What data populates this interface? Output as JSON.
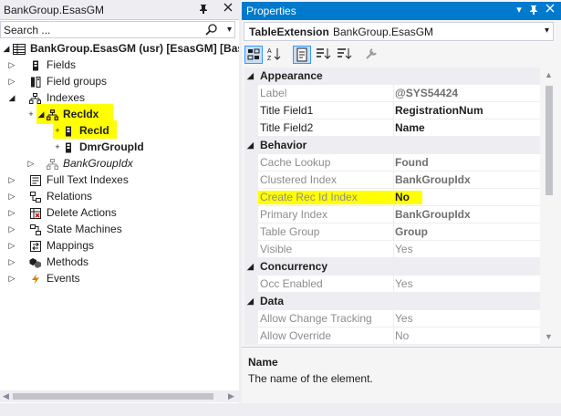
{
  "explorer": {
    "tab_title": "BankGroup.EsasGM",
    "search_placeholder": "Search ...",
    "root_label": "BankGroup.EsasGM (usr) [EsasGM] [Base:",
    "nodes": [
      {
        "label": "Fields",
        "icon": "fields-icon"
      },
      {
        "label": "Field groups",
        "icon": "field-groups-icon"
      },
      {
        "label": "Indexes",
        "icon": "indexes-icon"
      },
      {
        "label": "RecIdx",
        "icon": "index-icon"
      },
      {
        "label": "RecId",
        "icon": "field-icon"
      },
      {
        "label": "DmrGroupId",
        "icon": "field-icon"
      },
      {
        "label": "BankGroupIdx",
        "icon": "index-icon"
      },
      {
        "label": "Full Text Indexes",
        "icon": "full-text-indexes-icon"
      },
      {
        "label": "Relations",
        "icon": "relations-icon"
      },
      {
        "label": "Delete Actions",
        "icon": "delete-actions-icon"
      },
      {
        "label": "State Machines",
        "icon": "state-machines-icon"
      },
      {
        "label": "Mappings",
        "icon": "mappings-icon"
      },
      {
        "label": "Methods",
        "icon": "methods-icon"
      },
      {
        "label": "Events",
        "icon": "events-icon"
      }
    ]
  },
  "properties": {
    "title": "Properties",
    "object_type": "TableExtension",
    "object_name": "BankGroup.EsasGM",
    "categories": [
      {
        "title": "Appearance",
        "rows": [
          {
            "name": "Label",
            "value": "@SYS54424"
          },
          {
            "name": "Title Field1",
            "value": "RegistrationNum"
          },
          {
            "name": "Title Field2",
            "value": "Name"
          }
        ]
      },
      {
        "title": "Behavior",
        "rows": [
          {
            "name": "Cache Lookup",
            "value": "Found"
          },
          {
            "name": "Clustered Index",
            "value": "BankGroupIdx"
          },
          {
            "name": "Create Rec Id Index",
            "value": "No"
          },
          {
            "name": "Primary Index",
            "value": "BankGroupIdx"
          },
          {
            "name": "Table Group",
            "value": "Group"
          },
          {
            "name": "Visible",
            "value": "Yes"
          }
        ]
      },
      {
        "title": "Concurrency",
        "rows": [
          {
            "name": "Occ Enabled",
            "value": "Yes"
          }
        ]
      },
      {
        "title": "Data",
        "rows": [
          {
            "name": "Allow Change Tracking",
            "value": "Yes"
          },
          {
            "name": "Allow Override",
            "value": "No"
          }
        ]
      }
    ],
    "description_name": "Name",
    "description_text": "The name of the element."
  },
  "colors": {
    "accent": "#007acc",
    "highlight": "#ffff00"
  }
}
